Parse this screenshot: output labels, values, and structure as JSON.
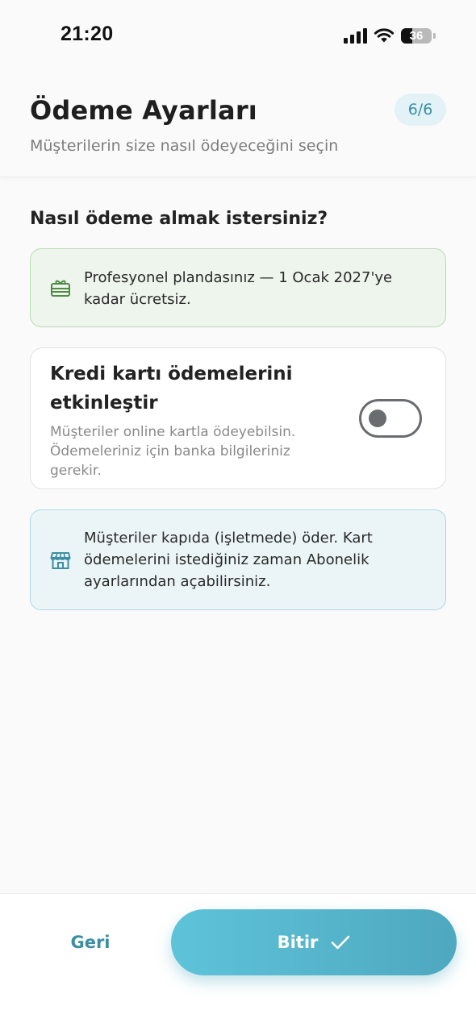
{
  "status_bar": {
    "time": "21:20",
    "battery_level": "36",
    "icons": [
      "signal-icon",
      "wifi-icon",
      "battery-icon"
    ]
  },
  "header": {
    "title": "Ödeme Ayarları",
    "subtitle": "Müşterilerin size nasıl ödeyeceğini seçin",
    "step": "6/6"
  },
  "content": {
    "section_title": "Nasıl ödeme almak istersiniz?",
    "promo": {
      "icon": "gift-card-icon",
      "text": "Profesyonel plandasınız — 1 Ocak 2027'ye kadar ücretsiz."
    },
    "credit_card": {
      "title": "Kredi kartı ödemelerini etkinleştir",
      "description": "Müşteriler online kartla ödeyebilsin. Ödemeleriniz için banka bilgileriniz gerekir.",
      "enabled": false
    },
    "info": {
      "icon": "store-icon",
      "text": "Müşteriler kapıda (işletmede) öder. Kart ödemelerini istediğiniz zaman Abonelik ayarlarından açabilirsiniz."
    }
  },
  "footer": {
    "back_label": "Geri",
    "finish_label": "Bitir",
    "finish_icon": "check-icon"
  },
  "colors": {
    "accent": "#4ea8bf",
    "promo_bg": "#edf5ec",
    "promo_border": "#b8dcb3",
    "info_bg": "#ebf5f8",
    "info_border": "#a9d9e7",
    "badge_bg": "#e3f2f7",
    "icon_green": "#4f8a45",
    "icon_teal": "#3d8ea3"
  }
}
